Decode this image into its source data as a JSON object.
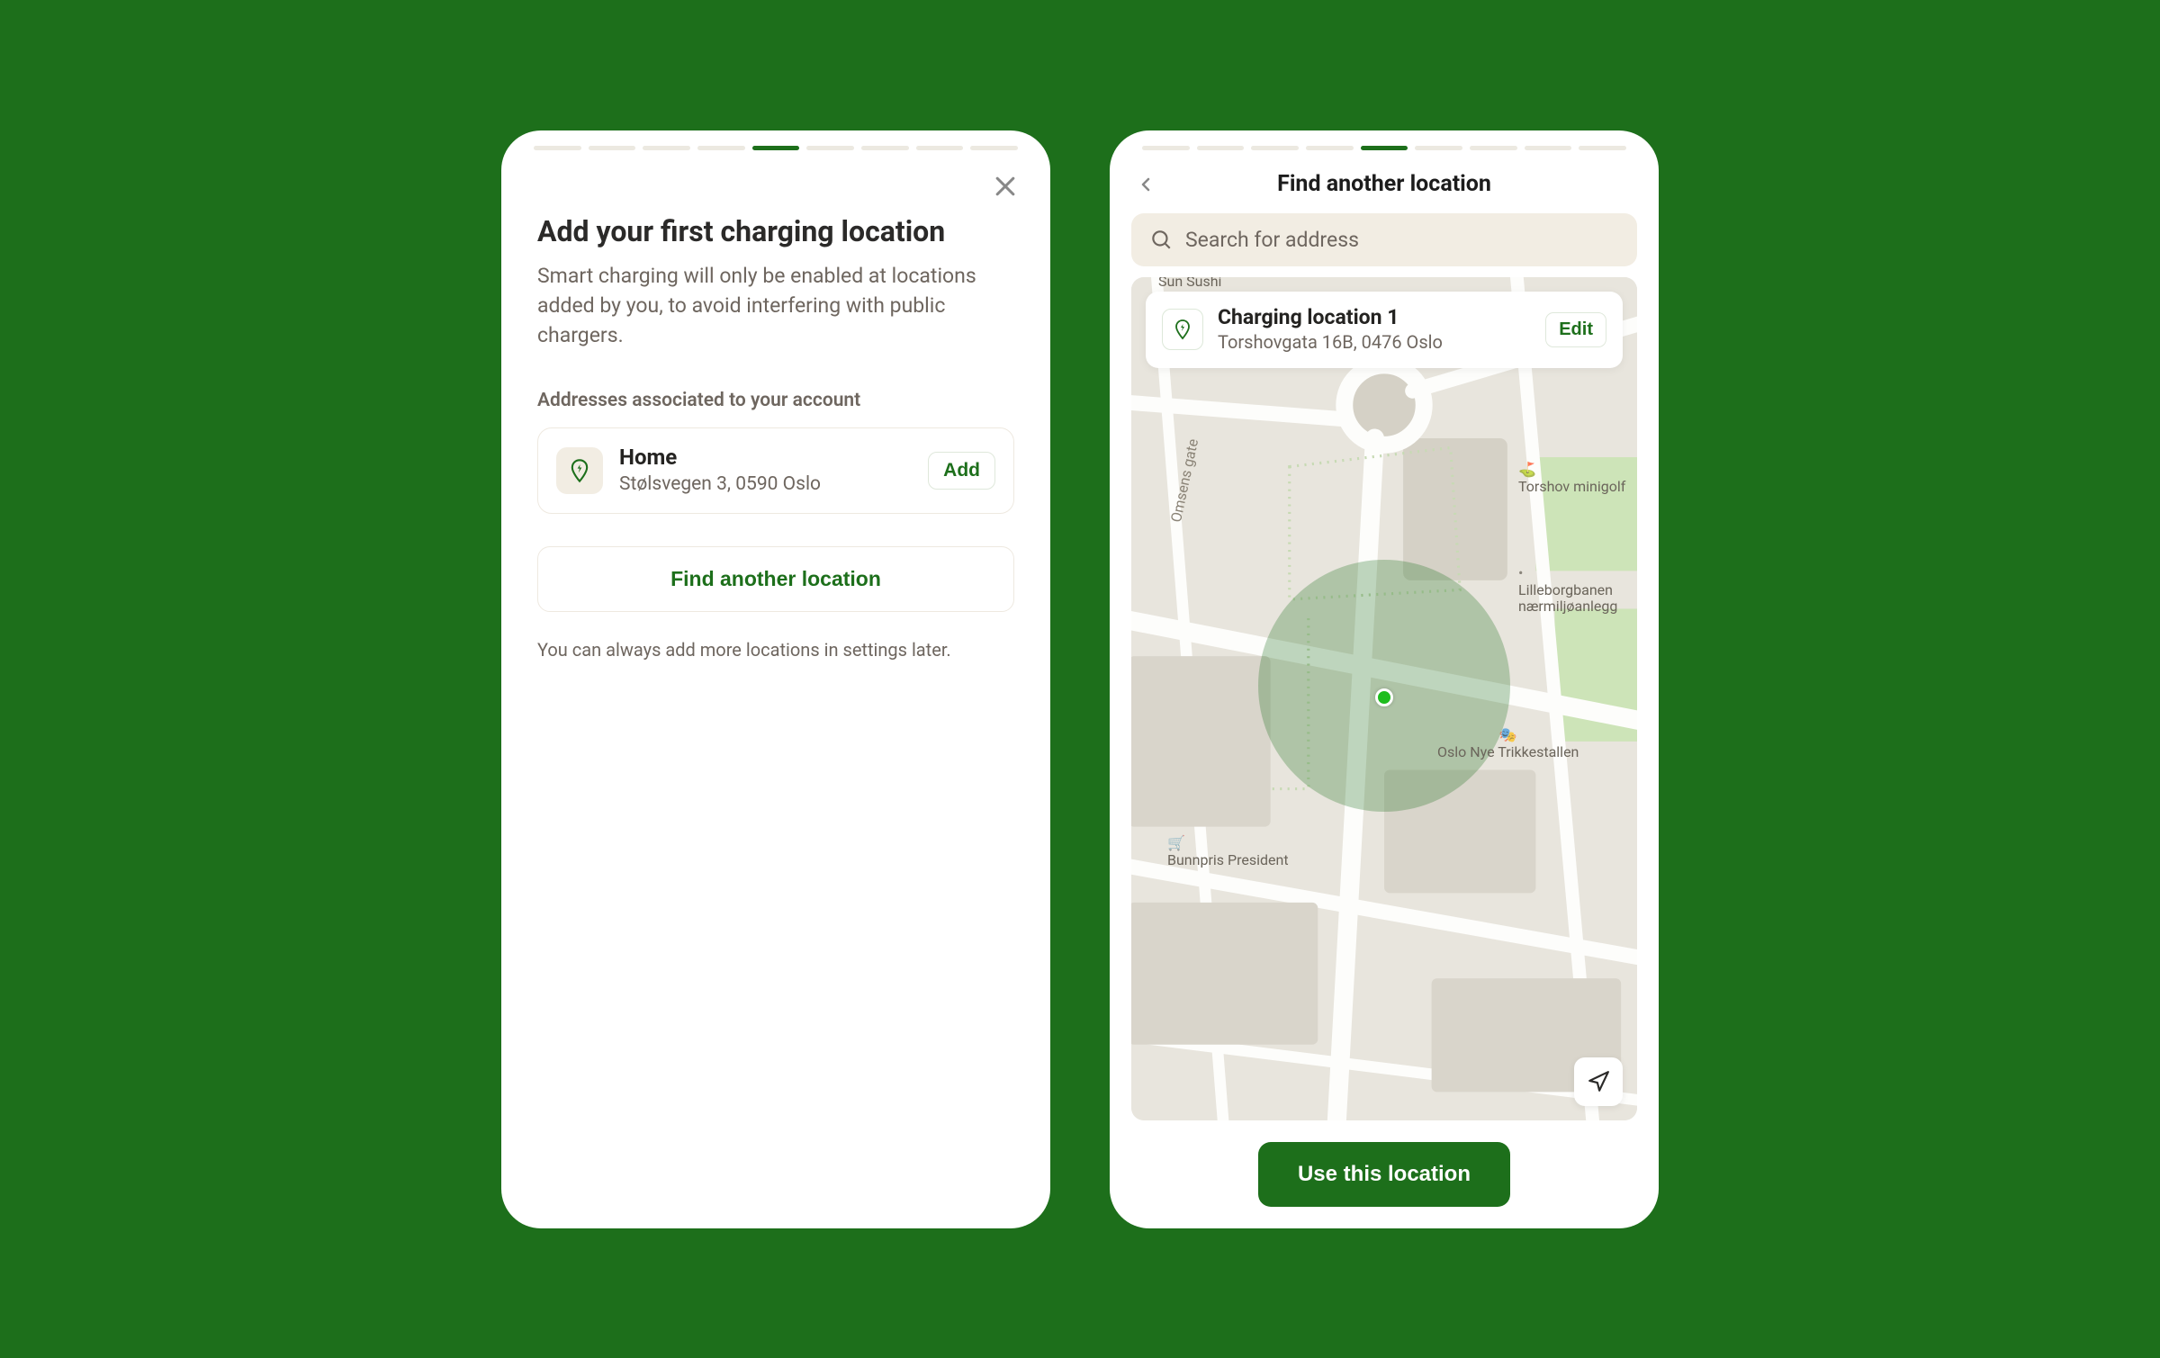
{
  "screen1": {
    "title": "Add your first charging location",
    "description": "Smart charging will only be enabled at locations added by you, to avoid interfering with public chargers.",
    "subheading": "Addresses associated to your account",
    "address": {
      "name": "Home",
      "line": "Stølsvegen 3, 0590 Oslo",
      "action": "Add"
    },
    "find_button": "Find another location",
    "note": "You can always add more locations in settings later."
  },
  "screen2": {
    "title": "Find another location",
    "search_placeholder": "Search for address",
    "location": {
      "name": "Charging location 1",
      "line": "Torshovgata 16B, 0476 Oslo",
      "action": "Edit"
    },
    "map_labels": {
      "street1": "Omsens gate",
      "poi1": "Torshov minigolf",
      "poi2": "Lilleborgbanen nærmiljøanlegg",
      "poi3": "Oslo Nye Trikkestallen",
      "poi4": "Bunnpris President",
      "poi5": "Sun Sushi"
    },
    "use_button": "Use this location"
  }
}
